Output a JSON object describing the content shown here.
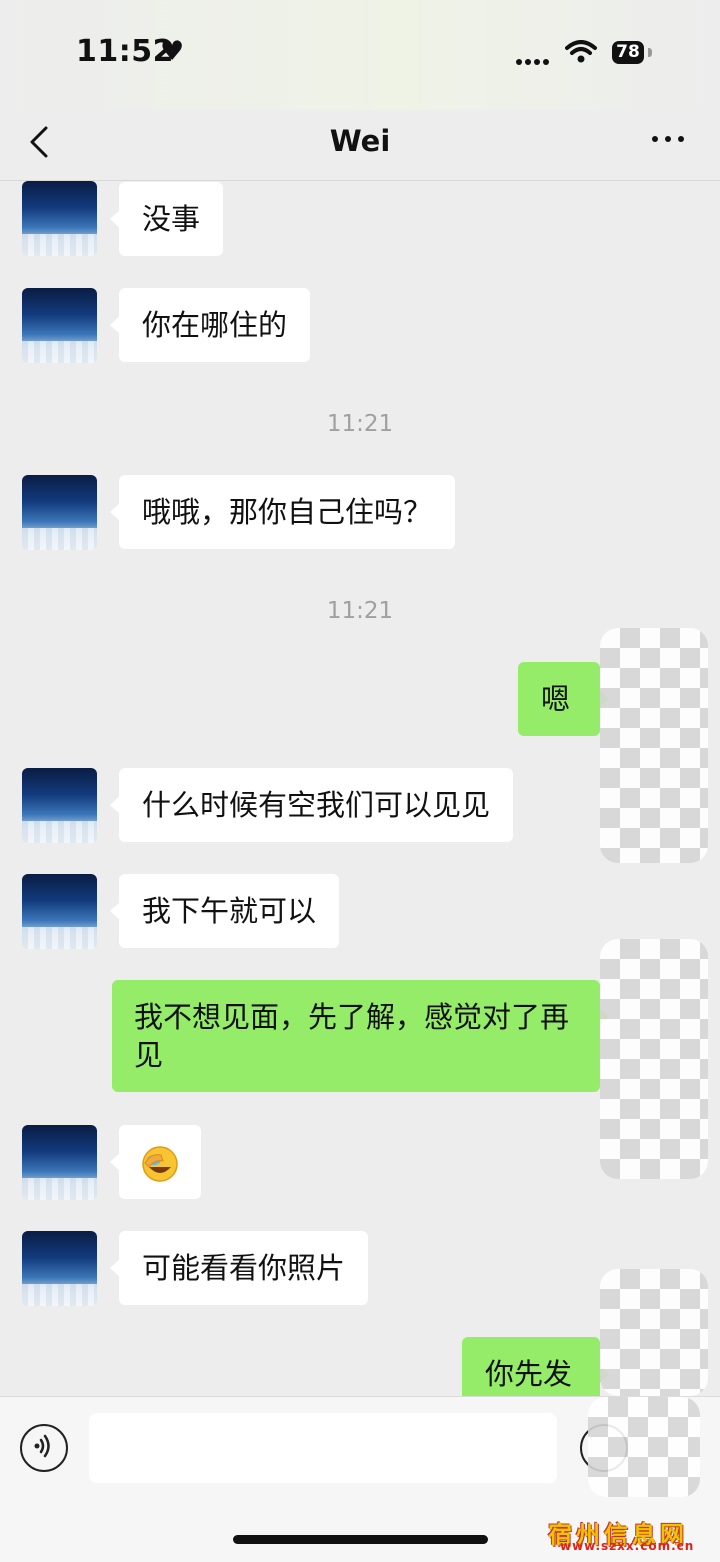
{
  "status_bar": {
    "time": "11:52",
    "battery": "78"
  },
  "header": {
    "title": "Wei"
  },
  "messages": {
    "m1": "没事",
    "m2": "你在哪住的",
    "t1": "11:21",
    "m3": "哦哦，那你自己住吗？",
    "t2": "11:21",
    "m4": "嗯",
    "m5": "什么时候有空我们可以见见",
    "m6": "我下午就可以",
    "m7": "我不想见面，先了解，感觉对了再见",
    "m8_emoji": "facepalm-laughing-emoji",
    "m9": "可能看看你照片",
    "m10": "你先发"
  },
  "watermark": {
    "title": "宿州信息网",
    "url": "www.szxx.com.cn"
  },
  "colors": {
    "sent_bubble": "#95ec69",
    "received_bubble": "#ffffff",
    "background": "#ededed"
  }
}
